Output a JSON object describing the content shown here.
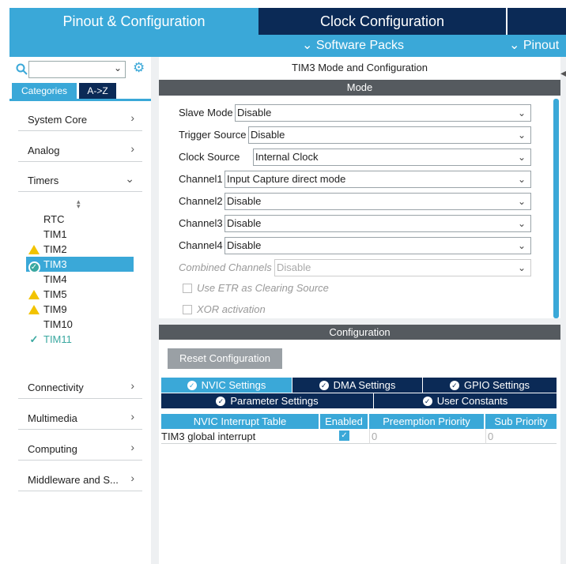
{
  "header": {
    "tab_pinout": "Pinout & Configuration",
    "tab_clock": "Clock Configuration",
    "software_packs": "Software Packs",
    "pinout": "Pinout"
  },
  "sidebar": {
    "search_placeholder": "",
    "tab_categories": "Categories",
    "tab_az": "A->Z",
    "categories": [
      {
        "label": "System Core"
      },
      {
        "label": "Analog"
      },
      {
        "label": "Timers"
      },
      {
        "label": "Connectivity"
      },
      {
        "label": "Multimedia"
      },
      {
        "label": "Computing"
      },
      {
        "label": "Middleware and S..."
      }
    ],
    "timers": [
      {
        "label": "RTC",
        "status": "none"
      },
      {
        "label": "TIM1",
        "status": "none"
      },
      {
        "label": "TIM2",
        "status": "warning"
      },
      {
        "label": "TIM3",
        "status": "selected-ok"
      },
      {
        "label": "TIM4",
        "status": "none"
      },
      {
        "label": "TIM5",
        "status": "warning"
      },
      {
        "label": "TIM9",
        "status": "warning"
      },
      {
        "label": "TIM10",
        "status": "none"
      },
      {
        "label": "TIM11",
        "status": "ok"
      }
    ]
  },
  "panel": {
    "title": "TIM3 Mode and Configuration",
    "mode_header": "Mode",
    "fields": [
      {
        "label": "Slave Mode",
        "value": "Disable"
      },
      {
        "label": "Trigger Source",
        "value": "Disable"
      },
      {
        "label": "Clock Source",
        "value": "Internal Clock"
      },
      {
        "label": "Channel1",
        "value": "Input Capture direct mode"
      },
      {
        "label": "Channel2",
        "value": "Disable"
      },
      {
        "label": "Channel3",
        "value": "Disable"
      },
      {
        "label": "Channel4",
        "value": "Disable"
      },
      {
        "label": "Combined Channels",
        "value": "Disable"
      }
    ],
    "checkboxes": [
      {
        "label": "Use ETR as Clearing Source"
      },
      {
        "label": "XOR activation"
      }
    ],
    "config_header": "Configuration",
    "reset_button": "Reset Configuration",
    "settings_tabs": [
      {
        "label": "NVIC Settings"
      },
      {
        "label": "DMA Settings"
      },
      {
        "label": "GPIO Settings"
      },
      {
        "label": "Parameter Settings"
      },
      {
        "label": "User Constants"
      }
    ],
    "table": {
      "headers": [
        "NVIC Interrupt Table",
        "Enabled",
        "Preemption Priority",
        "Sub Priority"
      ],
      "rows": [
        {
          "name": "TIM3 global interrupt",
          "enabled": true,
          "preemption": "0",
          "sub": "0"
        }
      ]
    }
  },
  "colors": {
    "accent": "#3aa8d8",
    "navy": "#0b2a56",
    "bar_gray": "#555a5f",
    "warning": "#f2c300",
    "ok_green": "#3aa8a0"
  }
}
